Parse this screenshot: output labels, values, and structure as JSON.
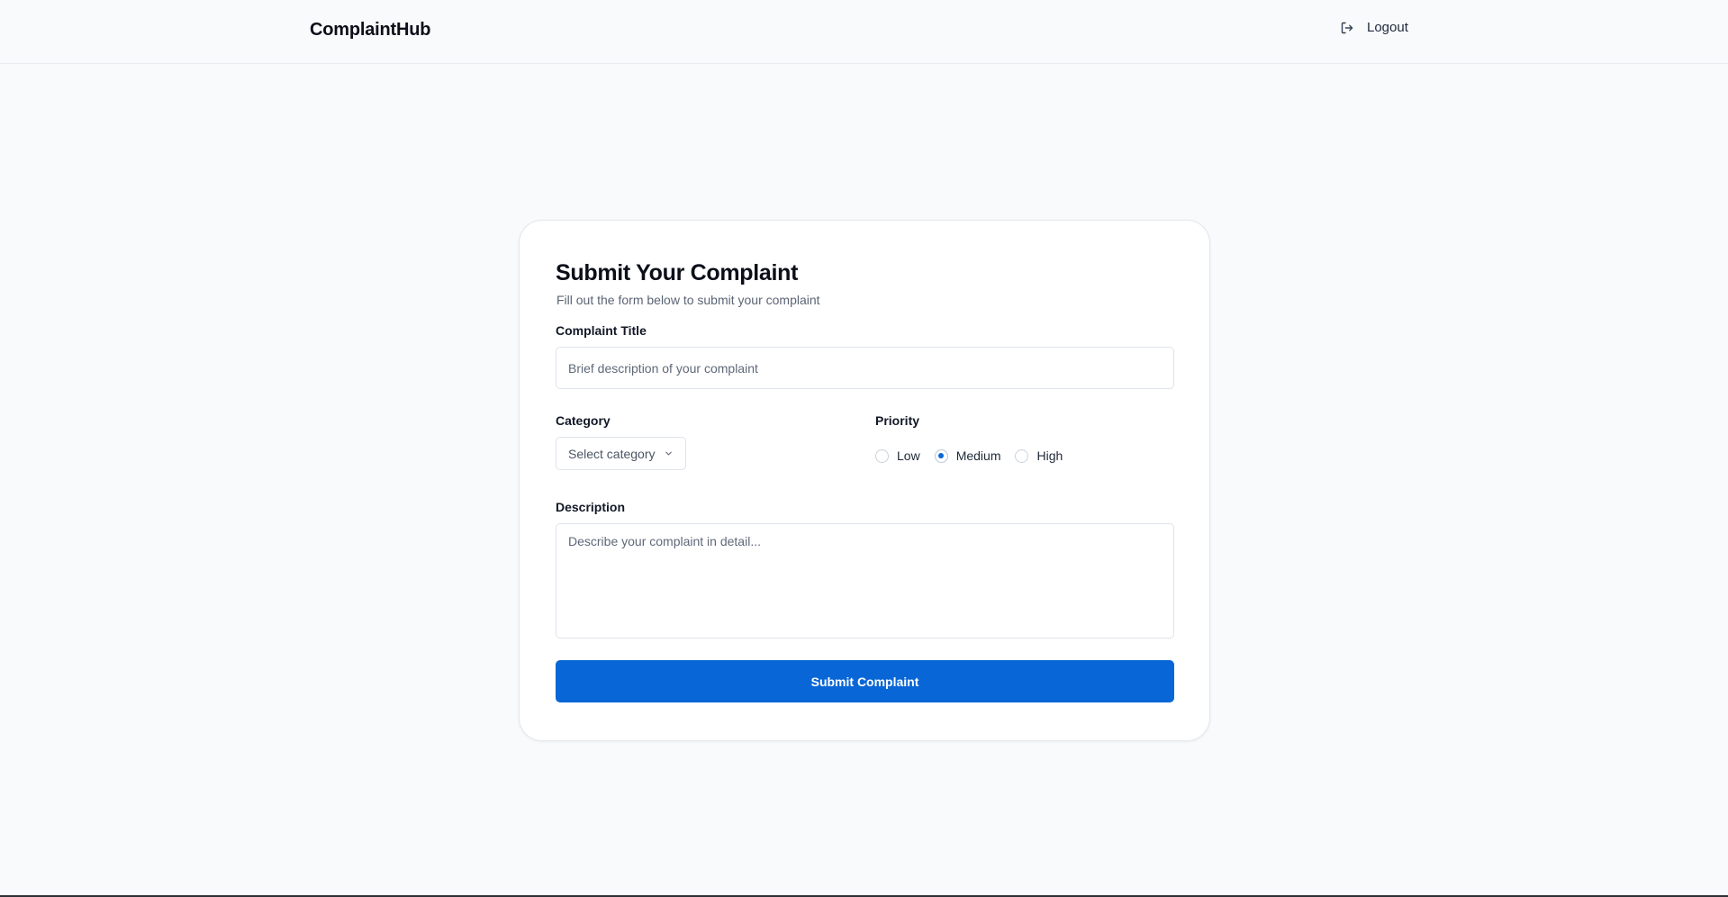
{
  "header": {
    "brand": "ComplaintHub",
    "logout_label": "Logout",
    "logout_icon": "logout-icon"
  },
  "form": {
    "title": "Submit Your Complaint",
    "subtitle": "Fill out the form below to submit your complaint",
    "complaint_title": {
      "label": "Complaint Title",
      "placeholder": "Brief description of your complaint",
      "value": ""
    },
    "category": {
      "label": "Category",
      "selected": "Select category",
      "icon": "chevron-down-icon"
    },
    "priority": {
      "label": "Priority",
      "options": [
        "Low",
        "Medium",
        "High"
      ],
      "selected": "Medium"
    },
    "description": {
      "label": "Description",
      "placeholder": "Describe your complaint in detail...",
      "value": ""
    },
    "submit_label": "Submit Complaint"
  },
  "colors": {
    "accent": "#0866d6",
    "background": "#f9fafc",
    "card": "#ffffff",
    "border": "#dfe3ea"
  }
}
